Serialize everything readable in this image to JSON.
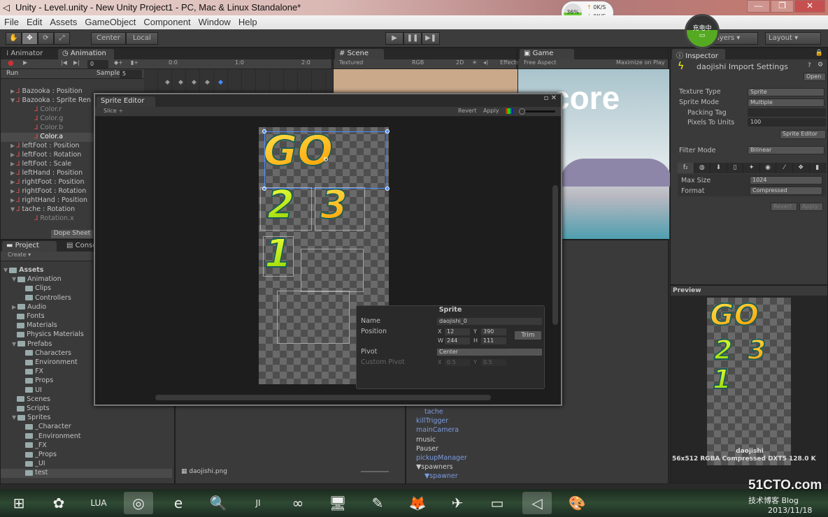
{
  "window": {
    "title": "Unity - Level.unity - New Unity Project1 - PC, Mac & Linux Standalone*",
    "controls": [
      "—",
      "❐",
      "✕"
    ]
  },
  "net_widget": {
    "percent": "36%",
    "up": "0K/S",
    "down": "0K/S"
  },
  "charging": {
    "label": "充电中"
  },
  "menu": [
    "File",
    "Edit",
    "Assets",
    "GameObject",
    "Component",
    "Window",
    "Help"
  ],
  "toolbar": {
    "tools": [
      "✋",
      "✥",
      "⟳",
      "⤢"
    ],
    "pivot": "Center",
    "space": "Local",
    "play": "▶",
    "pause": "❚❚",
    "step": "▶❚",
    "layers": "Layers",
    "layout": "Layout"
  },
  "animation": {
    "tabs": [
      "Animator",
      "Animation"
    ],
    "frame": "0",
    "clip": "Run",
    "sample_label": "Sample",
    "sample": "5",
    "ruler": [
      "0:0",
      "1:0",
      "2:0"
    ],
    "dope_sheet": "Dope Sheet",
    "tracks": [
      {
        "label": "Bazooka : Position",
        "indent": 0,
        "tri": "▶",
        "selected": false,
        "dim": false
      },
      {
        "label": "Bazooka : Sprite Ren",
        "indent": 0,
        "tri": "▼",
        "selected": false,
        "dim": false
      },
      {
        "label": "Color.r",
        "indent": 2,
        "tri": "",
        "selected": false,
        "dim": true
      },
      {
        "label": "Color.g",
        "indent": 2,
        "tri": "",
        "selected": false,
        "dim": true
      },
      {
        "label": "Color.b",
        "indent": 2,
        "tri": "",
        "selected": false,
        "dim": true
      },
      {
        "label": "Color.a",
        "indent": 2,
        "tri": "",
        "selected": true,
        "dim": false
      },
      {
        "label": "leftFoot : Position",
        "indent": 0,
        "tri": "▶",
        "selected": false,
        "dim": false
      },
      {
        "label": "leftFoot : Rotation",
        "indent": 0,
        "tri": "▶",
        "selected": false,
        "dim": false
      },
      {
        "label": "leftFoot : Scale",
        "indent": 0,
        "tri": "▶",
        "selected": false,
        "dim": false
      },
      {
        "label": "leftHand : Position",
        "indent": 0,
        "tri": "▶",
        "selected": false,
        "dim": false
      },
      {
        "label": "rightFoot : Position",
        "indent": 0,
        "tri": "▶",
        "selected": false,
        "dim": false
      },
      {
        "label": "rightFoot : Rotation",
        "indent": 0,
        "tri": "▶",
        "selected": false,
        "dim": false
      },
      {
        "label": "rightHand : Position",
        "indent": 0,
        "tri": "▶",
        "selected": false,
        "dim": false
      },
      {
        "label": "tache : Rotation",
        "indent": 0,
        "tri": "▼",
        "selected": false,
        "dim": false
      },
      {
        "label": "Rotation.x",
        "indent": 2,
        "tri": "",
        "selected": false,
        "dim": true
      }
    ]
  },
  "scene": {
    "tab": "Scene",
    "mode": "Textured",
    "color": "RGB",
    "btn2d": "2D",
    "effects": "Effects"
  },
  "game": {
    "tab": "Game",
    "aspect": "Free Aspect",
    "maximize": "Maximize on Play",
    "score_text": "core"
  },
  "project": {
    "tabs": [
      "Project",
      "Console"
    ],
    "create": "Create",
    "items": [
      {
        "label": "Assets",
        "indent": 0,
        "tri": "▼",
        "bold": true
      },
      {
        "label": "Animation",
        "indent": 1,
        "tri": "▼"
      },
      {
        "label": "Clips",
        "indent": 2,
        "tri": ""
      },
      {
        "label": "Controllers",
        "indent": 2,
        "tri": ""
      },
      {
        "label": "Audio",
        "indent": 1,
        "tri": "▶"
      },
      {
        "label": "Fonts",
        "indent": 1,
        "tri": ""
      },
      {
        "label": "Materials",
        "indent": 1,
        "tri": ""
      },
      {
        "label": "Physics Materials",
        "indent": 1,
        "tri": ""
      },
      {
        "label": "Prefabs",
        "indent": 1,
        "tri": "▼"
      },
      {
        "label": "Characters",
        "indent": 2,
        "tri": ""
      },
      {
        "label": "Environment",
        "indent": 2,
        "tri": ""
      },
      {
        "label": "FX",
        "indent": 2,
        "tri": ""
      },
      {
        "label": "Props",
        "indent": 2,
        "tri": ""
      },
      {
        "label": "UI",
        "indent": 2,
        "tri": ""
      },
      {
        "label": "Scenes",
        "indent": 1,
        "tri": ""
      },
      {
        "label": "Scripts",
        "indent": 1,
        "tri": ""
      },
      {
        "label": "Sprites",
        "indent": 1,
        "tri": "▼"
      },
      {
        "label": "_Character",
        "indent": 2,
        "tri": ""
      },
      {
        "label": "_Environment",
        "indent": 2,
        "tri": ""
      },
      {
        "label": "_FX",
        "indent": 2,
        "tri": ""
      },
      {
        "label": "_Props",
        "indent": 2,
        "tri": ""
      },
      {
        "label": "_UI",
        "indent": 2,
        "tri": ""
      },
      {
        "label": "test",
        "indent": 2,
        "tri": "",
        "selected": true
      }
    ],
    "selected_file": "daojishi.png"
  },
  "hierarchy": {
    "items": [
      {
        "label": "tache",
        "indent": 1,
        "prefab": true
      },
      {
        "label": "killTrigger",
        "indent": 0,
        "prefab": true
      },
      {
        "label": "mainCamera",
        "indent": 0,
        "prefab": true
      },
      {
        "label": "music",
        "indent": 0,
        "prefab": false
      },
      {
        "label": "Pauser",
        "indent": 0,
        "prefab": false
      },
      {
        "label": "pickupManager",
        "indent": 0,
        "prefab": true
      },
      {
        "label": "▼spawners",
        "indent": 0,
        "prefab": false
      },
      {
        "label": "▼spawner",
        "indent": 1,
        "prefab": true
      }
    ]
  },
  "inspector": {
    "tab": "Inspector",
    "title": "daojishi Import Settings",
    "open": "Open",
    "texture_type_label": "Texture Type",
    "texture_type": "Sprite",
    "sprite_mode_label": "Sprite Mode",
    "sprite_mode": "Multiple",
    "packing_tag_label": "Packing Tag",
    "packing_tag": "",
    "pixels_label": "Pixels To Units",
    "pixels": "100",
    "sprite_editor_btn": "Sprite Editor",
    "filter_label": "Filter Mode",
    "filter": "Bilinear",
    "platform_icons": [
      "f₂",
      "◍",
      "⬇",
      "▯",
      "✦",
      "◉",
      "⁄",
      "❖",
      "▮"
    ],
    "max_size_label": "Max Size",
    "max_size": "1024",
    "format_label": "Format",
    "format": "Compressed",
    "revert": "Revert",
    "apply": "Apply"
  },
  "preview": {
    "title": "Preview",
    "name": "daojishi",
    "info": "56x512  RGBA Compressed DXT5   128.0 K"
  },
  "sprite_editor": {
    "title": "Sprite Editor",
    "slice": "Slice",
    "revert": "Revert",
    "apply": "Apply",
    "sheet_text": {
      "go": "GO",
      "two": "2",
      "three": "3",
      "one": "1"
    },
    "panel": {
      "title": "Sprite",
      "name_label": "Name",
      "name": "daojishi_0",
      "position_label": "Position",
      "x": "12",
      "y": "390",
      "w": "244",
      "h": "111",
      "trim": "Trim",
      "pivot_label": "Pivot",
      "pivot": "Center",
      "custom_pivot_label": "Custom Pivot",
      "cx": "0.5",
      "cy": "0.5",
      "xl": "X",
      "yl": "Y",
      "wl": "W",
      "hl": "H"
    }
  },
  "taskbar": {
    "icons": [
      "⊞",
      "✿",
      "LUA",
      "◎",
      "e",
      "🔍",
      "JI",
      "∞",
      "🖥",
      "✎",
      "🦊",
      "✈",
      "▭",
      "◁",
      "🎨"
    ],
    "watermark": "51CTO.com",
    "watermark_sub": "技术博客 Blog",
    "date": "2013/11/18"
  }
}
